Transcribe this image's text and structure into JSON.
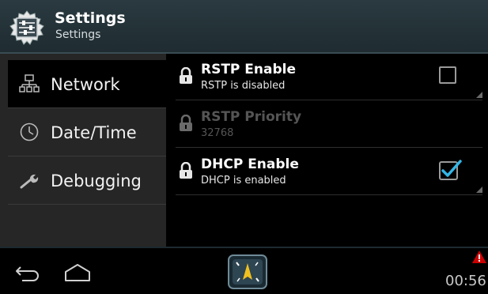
{
  "header": {
    "title": "Settings",
    "subtitle": "Settings",
    "icon": "settings-sliders-icon"
  },
  "nav": {
    "items": [
      {
        "label": "Network",
        "icon": "network-icon",
        "active": true
      },
      {
        "label": "Date/Time",
        "icon": "clock-icon",
        "active": false
      },
      {
        "label": "Debugging",
        "icon": "wrench-icon",
        "active": false
      }
    ]
  },
  "settings": {
    "rows": [
      {
        "title": "RSTP Enable",
        "subtitle": "RSTP is disabled",
        "checked": false,
        "enabled": true
      },
      {
        "title": "RSTP Priority",
        "subtitle": "32768",
        "enabled": false
      },
      {
        "title": "DHCP Enable",
        "subtitle": "DHCP is enabled",
        "checked": true,
        "enabled": true
      }
    ]
  },
  "system_bar": {
    "time": "00:56",
    "icons": [
      "back-icon",
      "home-icon",
      "compass-app-icon",
      "warning-icon"
    ]
  },
  "colors": {
    "accent": "#33b5e5",
    "header_bg": "#2a3a40",
    "nav_bg": "#262626",
    "warning": "#cc0000"
  }
}
